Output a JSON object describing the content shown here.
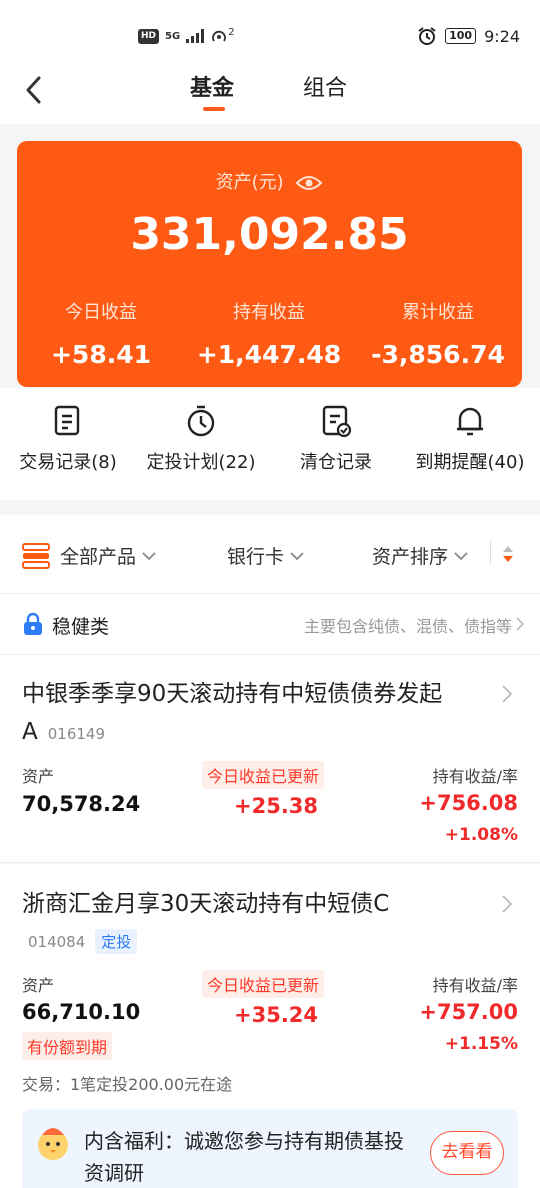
{
  "status_bar": {
    "left_hd": "HD",
    "left_network": "5G",
    "left_hotspot_count": "2",
    "battery": "100",
    "time": "9:24"
  },
  "header": {
    "tabs": [
      {
        "label": "基金",
        "active": true
      },
      {
        "label": "组合",
        "active": false
      }
    ]
  },
  "asset_card": {
    "label": "资产(元)",
    "total": "331,092.85",
    "stats": [
      {
        "label": "今日收益",
        "value": "+58.41"
      },
      {
        "label": "持有收益",
        "value": "+1,447.48"
      },
      {
        "label": "累计收益",
        "value": "-3,856.74"
      }
    ],
    "color": "#ff5a14"
  },
  "shortcuts": [
    {
      "label": "交易记录(8)",
      "icon": "document-icon"
    },
    {
      "label": "定投计划(22)",
      "icon": "timer-icon"
    },
    {
      "label": "清仓记录",
      "icon": "checked-document-icon"
    },
    {
      "label": "到期提醒(40)",
      "icon": "bell-icon"
    }
  ],
  "filters": {
    "product": "全部产品",
    "bank_card": "银行卡",
    "sort": "资产排序"
  },
  "category": {
    "title": "稳健类",
    "desc": "主要包含纯债、混债、债指等"
  },
  "funds": [
    {
      "name_line1": "中银季季享90天滚动持有中短债债券发起",
      "name_line2": "A",
      "code": "016149",
      "asset_label": "资产",
      "asset": "70,578.24",
      "updated_tag": "今日收益已更新",
      "today_gain": "+25.38",
      "hold_label": "持有收益/率",
      "hold_gain": "+756.08",
      "hold_rate": "+1.08%"
    },
    {
      "name_line1": "浙商汇金月享30天滚动持有中短债C",
      "code": "014084",
      "tag": "定投",
      "asset_label": "资产",
      "asset": "66,710.10",
      "updated_tag": "今日收益已更新",
      "today_gain": "+35.24",
      "hold_label": "持有收益/率",
      "hold_gain": "+757.00",
      "hold_rate": "+1.15%",
      "expiry_tag": "有份额到期",
      "trade_note": "交易：1笔定投200.00元在途"
    }
  ],
  "welfare": {
    "text": "内含福利：诚邀您参与持有期债基投资调研",
    "button": "去看看"
  }
}
